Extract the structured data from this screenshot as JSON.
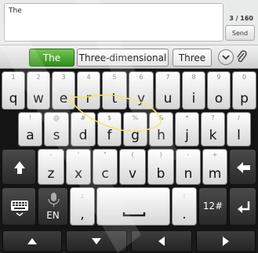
{
  "compose": {
    "message_text": "The",
    "char_counter": "3 / 160",
    "send_label": "Send"
  },
  "suggestions": {
    "items": [
      "The",
      "Three-dimensional",
      "Three"
    ],
    "selected_index": 0
  },
  "keyboard": {
    "row1": [
      {
        "main": "q",
        "sub": "1"
      },
      {
        "main": "w",
        "sub": "2"
      },
      {
        "main": "e",
        "sub": "3"
      },
      {
        "main": "r",
        "sub": "4"
      },
      {
        "main": "t",
        "sub": "5"
      },
      {
        "main": "y",
        "sub": "6"
      },
      {
        "main": "u",
        "sub": "7"
      },
      {
        "main": "i",
        "sub": "8"
      },
      {
        "main": "o",
        "sub": "9"
      },
      {
        "main": "p",
        "sub": "0"
      }
    ],
    "row2": [
      {
        "main": "a",
        "sub": "!"
      },
      {
        "main": "s",
        "sub": "@"
      },
      {
        "main": "d",
        "sub": "#"
      },
      {
        "main": "f",
        "sub": "$"
      },
      {
        "main": "g",
        "sub": "%"
      },
      {
        "main": "h",
        "sub": "&"
      },
      {
        "main": "j",
        "sub": "*"
      },
      {
        "main": "k",
        "sub": "?"
      },
      {
        "main": "l",
        "sub": "/"
      }
    ],
    "row3": [
      {
        "main": "z",
        "sub": "-"
      },
      {
        "main": "x",
        "sub": "'"
      },
      {
        "main": "c",
        "sub": "\""
      },
      {
        "main": "v",
        "sub": "("
      },
      {
        "main": "b",
        "sub": ")"
      },
      {
        "main": "n",
        "sub": "-"
      },
      {
        "main": "m",
        "sub": "+"
      }
    ],
    "lang_label": "EN",
    "comma_label": ",",
    "semicolon_label": ";",
    "colon_label": ":",
    "period_label": ".",
    "symbols_label": "12#"
  },
  "icons": {
    "shift": "shift-arrow-icon",
    "backspace": "backspace-arrow-icon",
    "keyboard": "keyboard-icon",
    "mic": "microphone-icon",
    "enter": "enter-icon",
    "space": "spacebar-icon",
    "nav": [
      "up-arrow-icon",
      "down-arrow-icon",
      "left-arrow-icon",
      "right-arrow-icon"
    ],
    "more": "chevron-down-icon",
    "attach": "paperclip-icon"
  },
  "colors": {
    "selected_suggestion": "#3ea824",
    "trace_line": "#f3e66a"
  }
}
